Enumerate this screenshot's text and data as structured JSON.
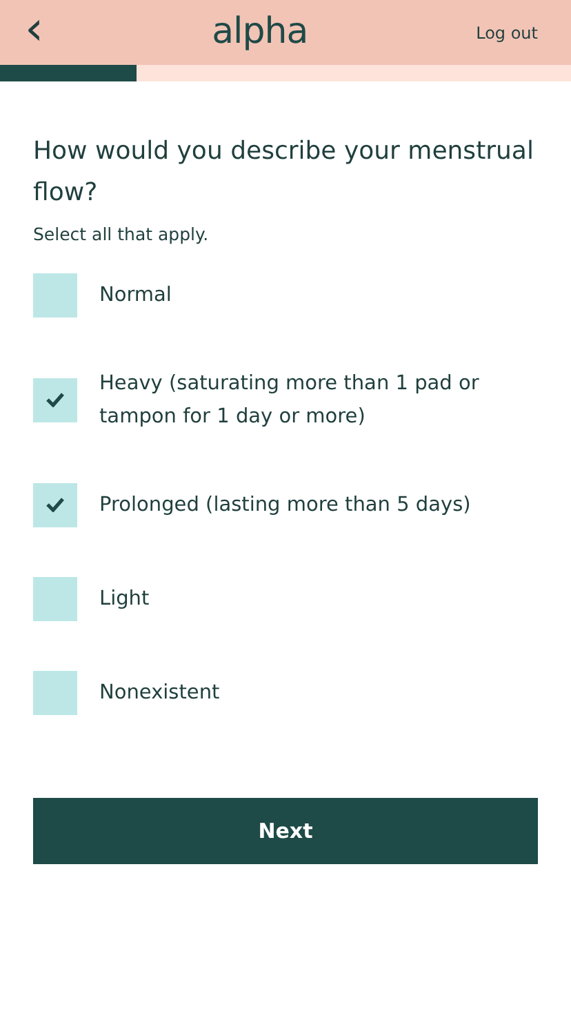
{
  "header": {
    "back": "‹",
    "logo": "alpha",
    "logout": "Log out"
  },
  "progress": {
    "level": 0.24
  },
  "question": "How would you describe your menstrual flow?",
  "hint": "Select all that apply.",
  "options": [
    {
      "label": "Normal",
      "checked": false
    },
    {
      "label": "Heavy (saturating more than 1 pad or tampon for 1 day or more)",
      "checked": true
    },
    {
      "label": "Prolonged (lasting more than 5 days)",
      "checked": true
    },
    {
      "label": "Light",
      "checked": false
    },
    {
      "label": "Nonexistent",
      "checked": false
    }
  ],
  "button": "Next"
}
